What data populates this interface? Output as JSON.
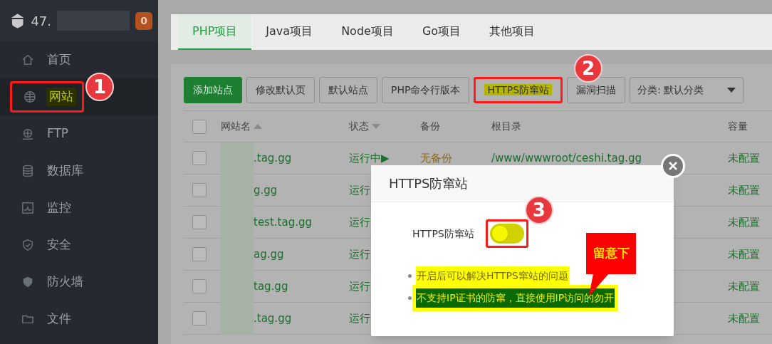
{
  "sidebar": {
    "host": "47.",
    "alert_count": "0",
    "items": [
      {
        "label": "首页",
        "selected": false
      },
      {
        "label": "网站",
        "selected": true
      },
      {
        "label": "FTP",
        "selected": false
      },
      {
        "label": "数据库",
        "selected": false
      },
      {
        "label": "监控",
        "selected": false
      },
      {
        "label": "安全",
        "selected": false
      },
      {
        "label": "防火墙",
        "selected": false
      },
      {
        "label": "文件",
        "selected": false
      }
    ]
  },
  "tabs": [
    {
      "label": "PHP项目",
      "selected": true
    },
    {
      "label": "Java项目",
      "selected": false
    },
    {
      "label": "Node项目",
      "selected": false
    },
    {
      "label": "Go项目",
      "selected": false
    },
    {
      "label": "其他项目",
      "selected": false
    }
  ],
  "toolbar": {
    "buttons": [
      {
        "label": "添加站点",
        "kind": "primary"
      },
      {
        "label": "修改默认页",
        "kind": "plain"
      },
      {
        "label": "默认站点",
        "kind": "plain"
      },
      {
        "label": "PHP命令行版本",
        "kind": "plain"
      },
      {
        "label": "HTTPS防窜站",
        "kind": "highlighted"
      },
      {
        "label": "漏洞扫描",
        "kind": "plain"
      }
    ],
    "category": "分类: 默认分类"
  },
  "table": {
    "all_checked": false,
    "columns": [
      {
        "label": "网站名",
        "sorted_up": true,
        "sorted_down": false
      },
      {
        "label": "状态",
        "sorted_up": false,
        "sorted_down": true
      },
      {
        "label": "备份"
      },
      {
        "label": "根目录"
      },
      {
        "label": "容量"
      }
    ],
    "rows": [
      {
        "checked": false,
        "name": ".tag.gg",
        "status": "运行中▶",
        "backup": "无备份",
        "root": "/www/wwwroot/ceshi.tag.gg",
        "capacity": "未配置"
      },
      {
        "checked": false,
        "name": "g.gg",
        "status": "运行",
        "capacity": "未配置"
      },
      {
        "checked": false,
        "name": "test.tag.gg",
        "status": "运行",
        "capacity": "未配置"
      },
      {
        "checked": false,
        "name": "ag.gg",
        "status": "运行",
        "capacity": "未配置"
      },
      {
        "checked": false,
        "name": "tag.gg",
        "status": "运行",
        "capacity": "未配置"
      },
      {
        "checked": false,
        "name": ".tag.gg",
        "status": "运行",
        "capacity": "未配置"
      }
    ]
  },
  "dialog": {
    "title": "HTTPS防窜站",
    "setting": {
      "label": "HTTPS防窜站",
      "on": false
    },
    "notes": [
      {
        "text": "开启后可以解决HTTPS窜站的问题",
        "kind": "highlight"
      },
      {
        "text": "不支持IP证书的防窜，直接使用IP访问的勿开",
        "kind": "selected"
      }
    ]
  },
  "annotations": {
    "markers": [
      "1",
      "2",
      "3"
    ],
    "callout": "留意下"
  }
}
